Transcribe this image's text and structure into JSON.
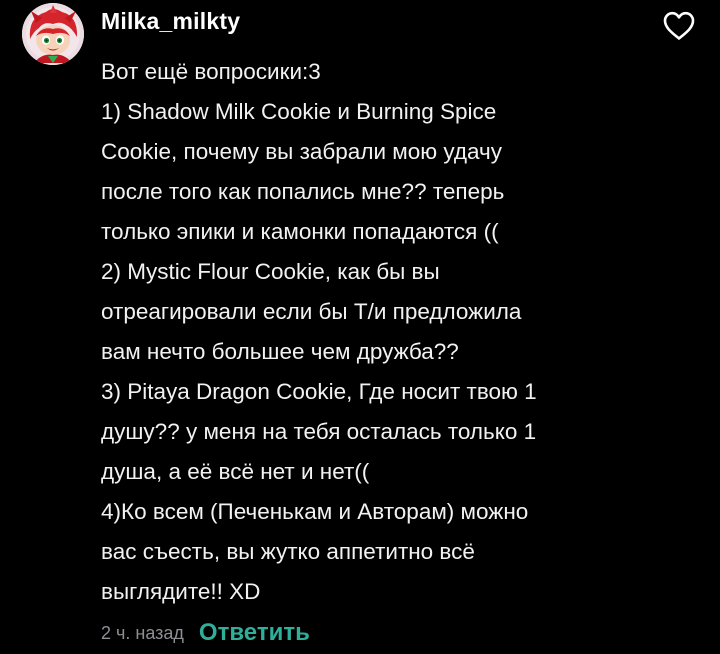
{
  "comment": {
    "author": {
      "username": "Milka_milkty",
      "avatar_icon": "avatar-red-cookie-character"
    },
    "like_icon": "heart-outline-icon",
    "lines": [
      "Вот ещё вопросики:3",
      "1) Shadow Milk Cookie и Burning Spice",
      "Cookie, почему вы забрали мою удачу",
      "после того как попались мне?? теперь",
      "только эпики и камонки попадаются ((",
      "2) Mystic Flour Cookie, как бы вы",
      "отреагировали если бы Т/и предложила",
      "вам нечто большее чем дружба??",
      "3) Pitaya Dragon Cookie, Где носит твою 1",
      "душу?? у меня на тебя осталась только 1",
      "душа, а её всё нет и нет((",
      "4)Ко всем (Печенькам и Авторам) можно",
      "вас съесть, вы жутко аппетитно всё",
      "выглядите!! XD"
    ],
    "timestamp": "2 ч. назад",
    "reply_label": "Ответить"
  },
  "colors": {
    "background": "#000000",
    "text": "#f2f2f2",
    "muted": "#8e8e93",
    "accent": "#2fae9a"
  }
}
